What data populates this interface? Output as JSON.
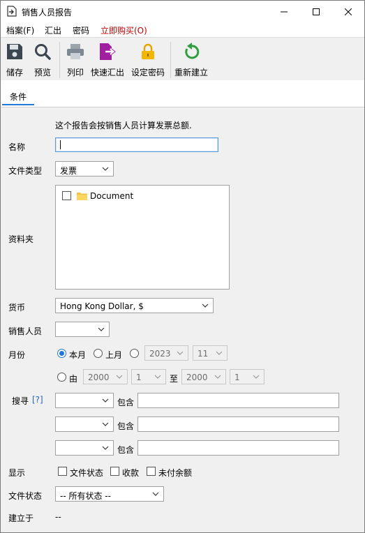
{
  "window": {
    "title": "销售人员报告"
  },
  "menu": [
    {
      "label": "档案(F)"
    },
    {
      "label": "汇出"
    },
    {
      "label": "密码"
    },
    {
      "label": "立即购买(O)"
    }
  ],
  "toolbar": {
    "save": "储存",
    "preview": "预览",
    "print": "列印",
    "quick_export": "快速汇出",
    "set_password": "设定密码",
    "rebuild": "重新建立"
  },
  "tabs": [
    {
      "label": "条件"
    }
  ],
  "form": {
    "description": "这个报告会按销售人员计算发票总额.",
    "name_label": "名称",
    "name_value": "",
    "doc_type_label": "文件类型",
    "doc_type_value": "发票",
    "folder_label": "资料夹",
    "folder_item": "Document",
    "currency_label": "货币",
    "currency_value": "Hong Kong Dollar, $",
    "salesperson_label": "销售人员",
    "salesperson_value": "",
    "month_label": "月份",
    "this_month": "本月",
    "last_month": "上月",
    "year_value": "2023",
    "month_value": "11",
    "from_label": "由",
    "from_year": "2000",
    "from_month": "1",
    "to_label": "至",
    "to_year": "2000",
    "to_month": "1",
    "search_label": "搜寻",
    "search_help": "[?]",
    "contains_label": "包含",
    "search_rows": [
      {
        "field": "",
        "value": ""
      },
      {
        "field": "",
        "value": ""
      },
      {
        "field": "",
        "value": ""
      }
    ],
    "display_label": "显示",
    "show_doc_status": "文件状态",
    "show_payment": "收款",
    "show_unpaid": "未付余额",
    "doc_status_label": "文件状态",
    "doc_status_value": "-- 所有状态 --",
    "created_label": "建立于",
    "created_value": "--"
  },
  "colors": {
    "accent": "#1e78d7",
    "buy_now": "#c00000",
    "purple": "#a020a0",
    "green": "#2e9e3e",
    "gold": "#f2b600"
  }
}
